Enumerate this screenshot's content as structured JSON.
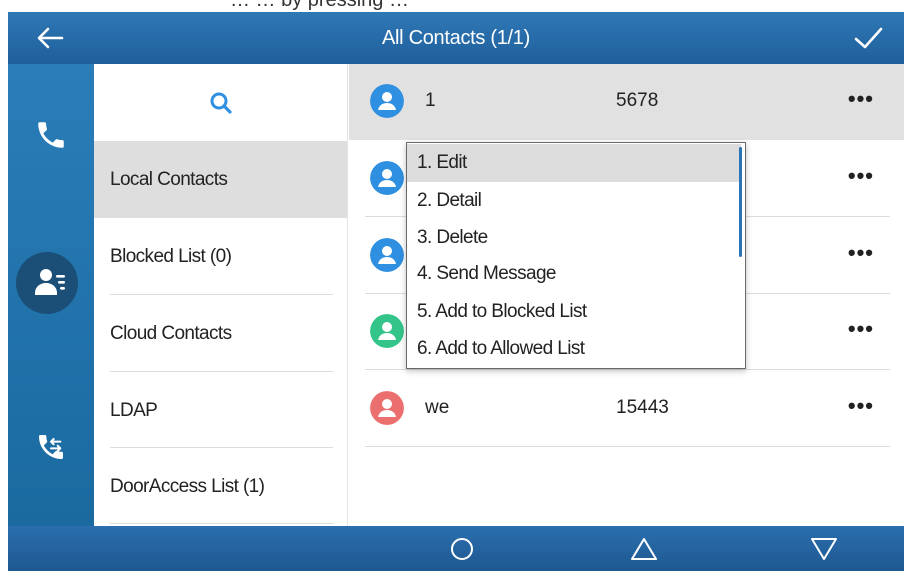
{
  "caption": {
    "text": "… … by pressing …"
  },
  "header": {
    "title": "All Contacts (1/1)",
    "back_icon": "back-arrow-icon",
    "confirm_icon": "checkmark-icon"
  },
  "rail": {
    "items": [
      {
        "icon": "phone-icon"
      },
      {
        "icon": "contacts-icon",
        "active": true
      },
      {
        "icon": "call-history-icon"
      }
    ]
  },
  "sources": {
    "search_icon": "search-icon",
    "items": [
      {
        "label": "Local Contacts",
        "selected": true
      },
      {
        "label": "Blocked List (0)"
      },
      {
        "label": "Cloud Contacts"
      },
      {
        "label": "LDAP"
      },
      {
        "label": "DoorAccess List (1)"
      }
    ]
  },
  "contacts": {
    "rows": [
      {
        "name": "1",
        "number": "5678",
        "avatar_color": "#2f8fe0",
        "selected": true,
        "more": "•••"
      },
      {
        "name": "",
        "number": "",
        "avatar_color": "#2f8fe0",
        "more": "•••"
      },
      {
        "name": "",
        "number": "",
        "avatar_color": "#2f8fe0",
        "more": "•••"
      },
      {
        "name": "",
        "number": "",
        "avatar_color": "#33c48a",
        "more": "•••"
      },
      {
        "name": "we",
        "number": "15443",
        "avatar_color": "#ec6f6f",
        "more": "•••"
      }
    ]
  },
  "menu": {
    "items": [
      {
        "label": "1. Edit",
        "highlighted": true
      },
      {
        "label": "2. Detail"
      },
      {
        "label": "3. Delete"
      },
      {
        "label": "4. Send Message"
      },
      {
        "label": "5.  Add to Blocked List"
      },
      {
        "label": "6.  Add to Allowed List"
      }
    ]
  },
  "bottom_nav": {
    "items": [
      {
        "icon": "circle-home-icon"
      },
      {
        "icon": "triangle-up-icon"
      },
      {
        "icon": "triangle-down-icon"
      }
    ]
  },
  "colors": {
    "header_blue": "#2f78b6",
    "rail_blue": "#2a7db8",
    "rail_active": "#1b4f78",
    "selection_gray": "#dedede"
  }
}
